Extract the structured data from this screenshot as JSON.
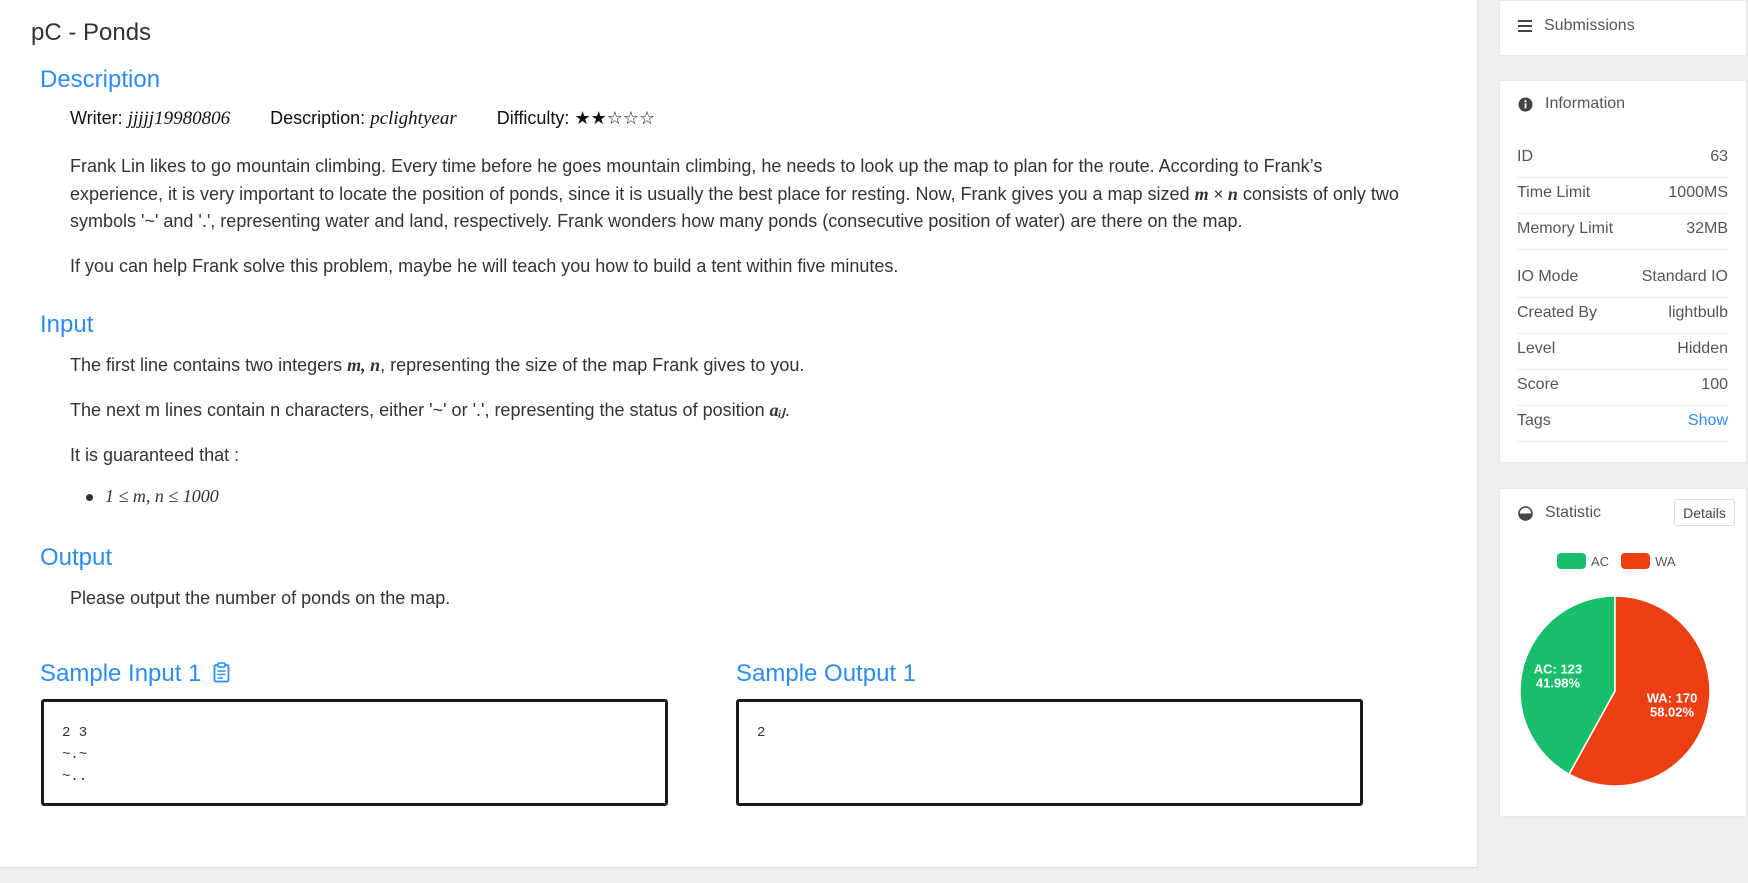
{
  "title": "pC - Ponds",
  "description": {
    "heading": "Description",
    "writer_label": "Writer:",
    "writer": "jjjjj19980806",
    "desc_label": "Description:",
    "desc_author": "pclightyear",
    "difficulty_label": "Difficulty:",
    "difficulty_stars": "★★☆☆☆",
    "para1_a": "Frank Lin likes to go mountain climbing. Every time before he goes mountain climbing, he needs to look up the map to plan for the route. According to Frank’s experience, it is very important to locate the position of ponds, since it is usually the best place for resting. Now, Frank gives you a map sized ",
    "para1_math": "m × n",
    "para1_b": " consists of only two symbols '~' and '.', representing water and land, respectively. Frank wonders how many ponds (consecutive position of water) are there on the map.",
    "para2": "If you can help Frank solve this problem, maybe he will teach you how to build a tent within five minutes."
  },
  "input": {
    "heading": "Input",
    "line1_a": "The first line contains two integers ",
    "line1_math": "m, n",
    "line1_b": ", representing the size of the map Frank gives to you.",
    "line2_a": "The next m lines contain n characters, either '~' or '.', representing the status of position ",
    "line2_math": "aᵢⱼ",
    "line2_b": ".",
    "line3": "It is guaranteed that :",
    "constraint": "1 ≤ m, n ≤ 1000"
  },
  "output": {
    "heading": "Output",
    "text": "Please output the number of ponds on the map."
  },
  "samples": {
    "input_heading": "Sample Input 1",
    "input_text": "2 3\n~.~\n~..",
    "output_heading": "Sample Output 1",
    "output_text": "2"
  },
  "sidebar": {
    "submissions_label": "Submissions",
    "information_label": "Information",
    "info": [
      {
        "key": "ID",
        "value": "63"
      },
      {
        "key": "Time Limit",
        "value": "1000MS"
      },
      {
        "key": "Memory Limit",
        "value": "32MB"
      },
      {
        "key": "IO Mode",
        "value": "Standard IO"
      },
      {
        "key": "Created By",
        "value": "lightbulb"
      },
      {
        "key": "Level",
        "value": "Hidden"
      },
      {
        "key": "Score",
        "value": "100"
      },
      {
        "key": "Tags",
        "value": "Show"
      }
    ],
    "statistic_label": "Statistic",
    "details_label": "Details"
  },
  "colors": {
    "accent": "#2d8cf0",
    "ac": "#19be6b",
    "wa": "#ed3f14"
  },
  "chart_data": {
    "type": "pie",
    "categories": [
      "AC",
      "WA"
    ],
    "values": [
      123,
      170
    ],
    "percent": [
      "41.98%",
      "58.02%"
    ],
    "labels": [
      "AC: 123",
      "WA: 170"
    ],
    "legend": "top"
  }
}
